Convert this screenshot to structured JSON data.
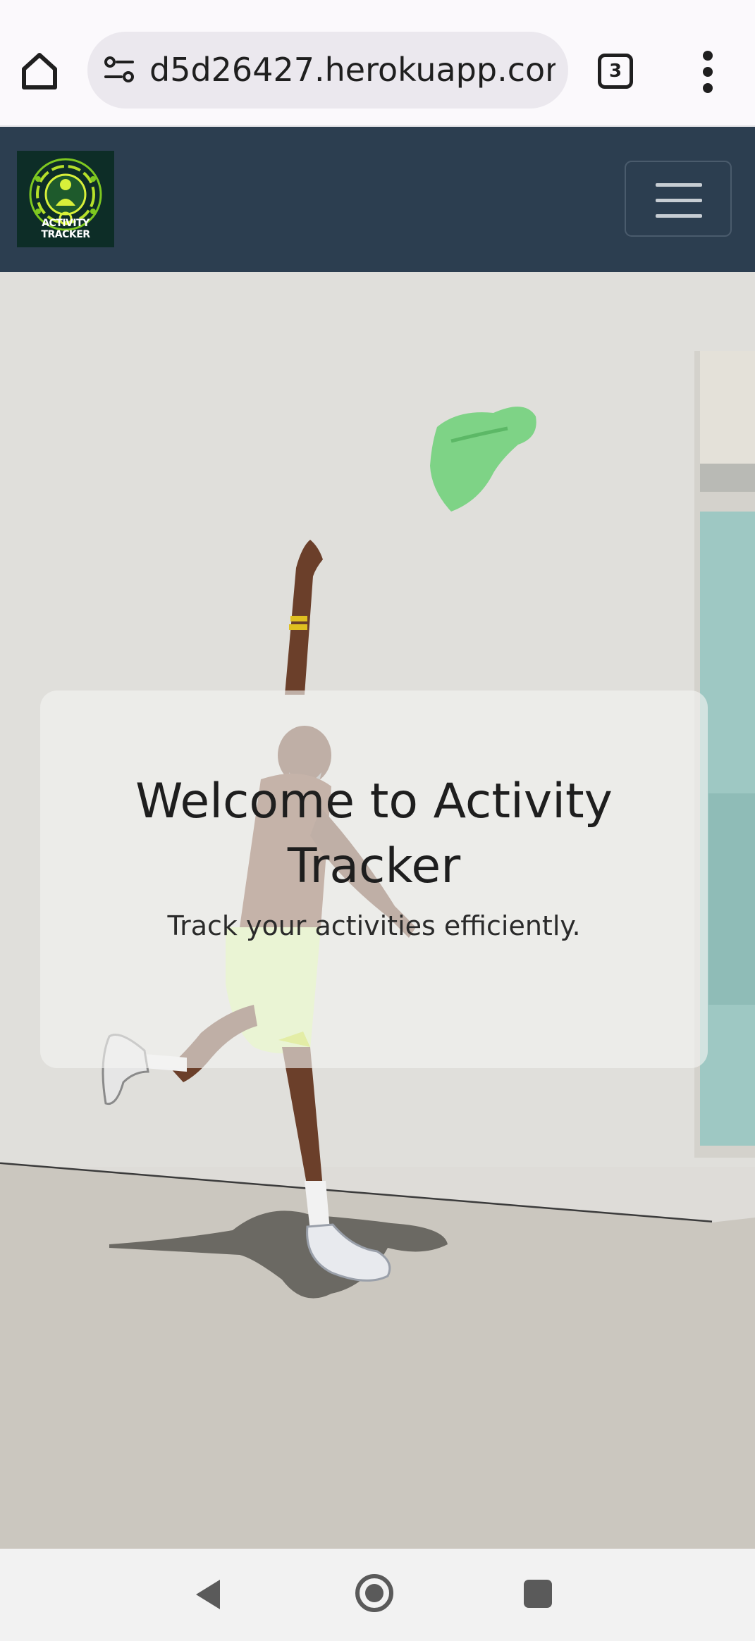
{
  "browser": {
    "url": "d5d26427.herokuapp.com",
    "tab_count": "3",
    "icons": {
      "home": "home-icon",
      "site_info": "tune-icon",
      "tabs": "tab-switcher-icon",
      "menu": "more-vert-icon"
    }
  },
  "navbar": {
    "logo_text": "ACTIVITY TRACKER",
    "logo_alt": "activity-tracker-logo",
    "toggler_icon": "hamburger-icon",
    "background_color": "#2c3e50"
  },
  "hero": {
    "title": "Welcome to Activity Tracker",
    "subtitle": "Track your activities efficiently.",
    "background_image": "man-jumping-throwing-green-shirt"
  },
  "system_nav": {
    "icons": [
      "back-icon",
      "home-icon",
      "recents-icon"
    ]
  }
}
